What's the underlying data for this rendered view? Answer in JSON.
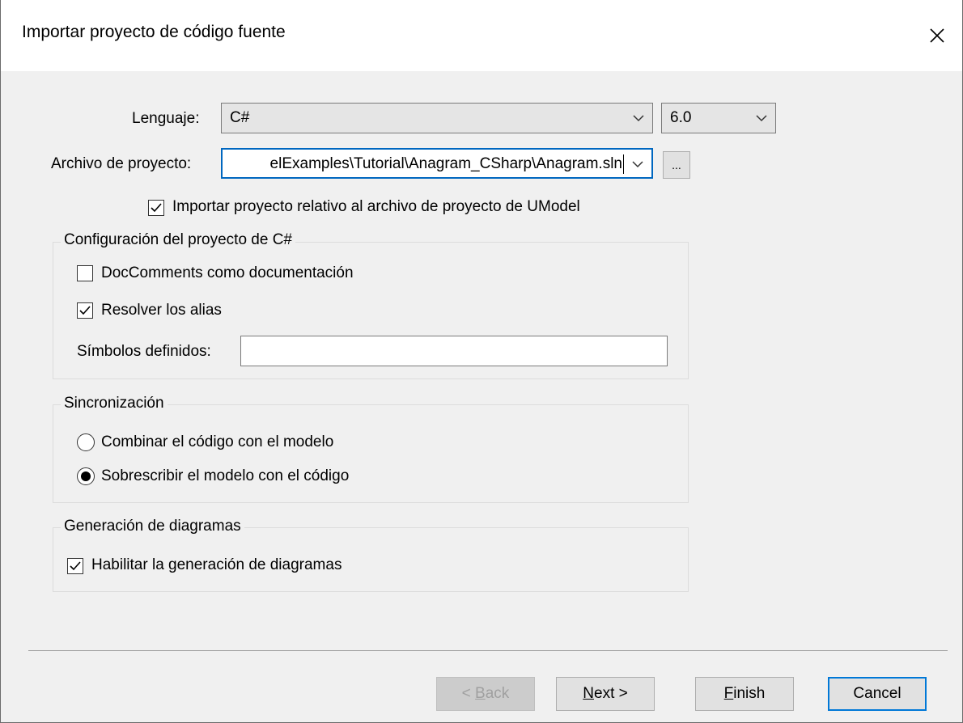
{
  "dialog": {
    "title": "Importar proyecto de código fuente"
  },
  "language": {
    "label": "Lenguaje:",
    "value": "C#",
    "version": "6.0"
  },
  "project_file": {
    "label": "Archivo de proyecto:",
    "value": "elExamples\\Tutorial\\Anagram_CSharp\\Anagram.sln",
    "browse_label": "..."
  },
  "relative_import": {
    "label": "Importar proyecto relativo al archivo de proyecto de UModel",
    "checked": true
  },
  "csharp_settings": {
    "title": "Configuración del proyecto de C#",
    "doccomments_label": "DocComments como documentación",
    "doccomments_checked": false,
    "resolve_alias_label": "Resolver los alias",
    "resolve_alias_checked": true,
    "defined_symbols_label": "Símbolos definidos:",
    "defined_symbols_value": ""
  },
  "sync": {
    "title": "Sincronización",
    "merge_label": "Combinar el código con el modelo",
    "overwrite_label": "Sobrescribir el modelo con el código",
    "selected": "overwrite"
  },
  "diagrams": {
    "title": "Generación de diagramas",
    "enable_label": "Habilitar la generación de diagramas",
    "enable_checked": true
  },
  "buttons": {
    "back_prefix": "< ",
    "back_mnemonic": "B",
    "back_rest": "ack",
    "next_mnemonic": "N",
    "next_rest": "ext >",
    "finish_mnemonic": "F",
    "finish_rest": "inish",
    "cancel": "Cancel"
  },
  "icons": {
    "close": "close-icon",
    "dropdown": "chevron-down-icon",
    "check": "checkmark-icon"
  }
}
